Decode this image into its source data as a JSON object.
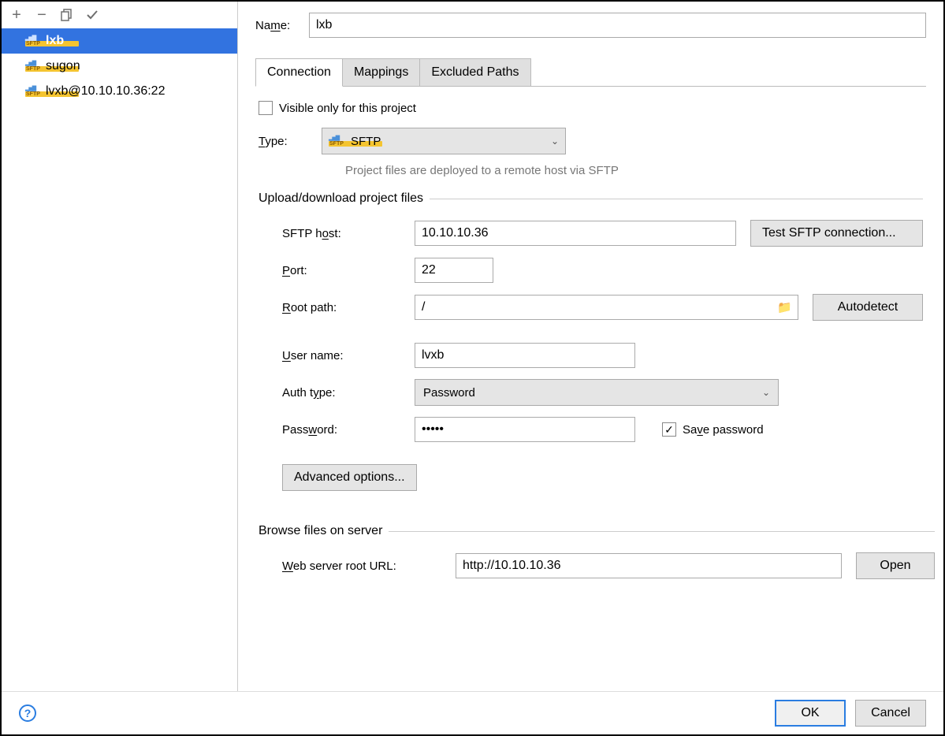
{
  "sidebar": {
    "servers": [
      {
        "name": "lxb",
        "selected": true
      },
      {
        "name": "sugon",
        "selected": false
      },
      {
        "name": "lvxb@10.10.10.36:22",
        "selected": false
      }
    ]
  },
  "header": {
    "name_label": "Name:",
    "name_value": "lxb"
  },
  "tabs": {
    "connection": "Connection",
    "mappings": "Mappings",
    "excluded": "Excluded Paths"
  },
  "conn": {
    "visible_label": "Visible only for this project",
    "visible_checked": false,
    "type_label": "Type:",
    "type_value": "SFTP",
    "type_desc": "Project files are deployed to a remote host via SFTP",
    "upload_legend": "Upload/download project files",
    "sftp_host_label": "SFTP host:",
    "sftp_host": "10.10.10.36",
    "test_btn": "Test SFTP connection...",
    "port_label": "Port:",
    "port": "22",
    "root_label": "Root path:",
    "root": "/",
    "autodetect_btn": "Autodetect",
    "user_label": "User name:",
    "user": "lvxb",
    "auth_label": "Auth type:",
    "auth_value": "Password",
    "password_label": "Password:",
    "password_value": "•••••",
    "save_pw_label": "Save password",
    "save_pw_checked": true,
    "adv_btn": "Advanced options...",
    "browse_legend": "Browse files on server",
    "web_url_label": "Web server root URL:",
    "web_url": "http://10.10.10.36",
    "open_btn": "Open"
  },
  "footer": {
    "ok": "OK",
    "cancel": "Cancel"
  }
}
